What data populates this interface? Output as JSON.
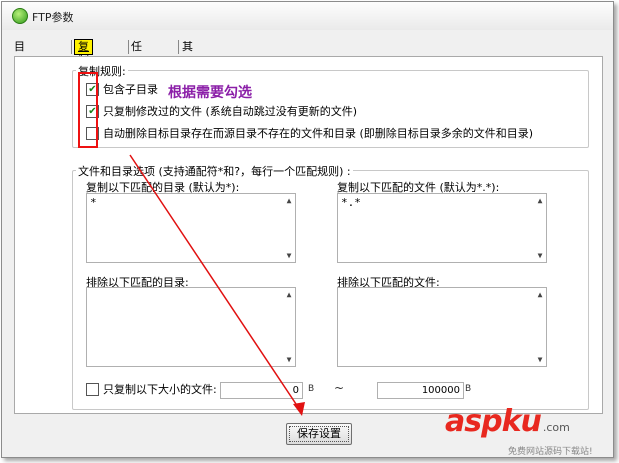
{
  "window": {
    "title": "FTP参数"
  },
  "tabs": [
    {
      "label": "目录设置",
      "active": false
    },
    {
      "label": "复制规则",
      "active": true
    },
    {
      "label": "任务计划",
      "active": false
    },
    {
      "label": "其他选项",
      "active": false
    }
  ],
  "copy_rules": {
    "group_label": "复制规则:",
    "options": [
      {
        "label": "包含子目录",
        "checked": true
      },
      {
        "label": "只复制修改过的文件 (系统自动跳过没有更新的文件)",
        "checked": true
      },
      {
        "label": "自动删除目标目录存在而源目录不存在的文件和目录 (即删除目标目录多余的文件和目录)",
        "checked": false
      }
    ],
    "annotation": "根据需要勾选"
  },
  "filters": {
    "group_label": "文件和目录选项 (支持通配符*和?，每行一个匹配规则) :",
    "copy_dirs_label": "复制以下匹配的目录 (默认为*):",
    "copy_dirs_value": "*",
    "copy_files_label": "复制以下匹配的文件 (默认为*.*):",
    "copy_files_value": "*.*",
    "exclude_dirs_label": "排除以下匹配的目录:",
    "exclude_dirs_value": "",
    "exclude_files_label": "排除以下匹配的文件:",
    "exclude_files_value": "",
    "size_filter": {
      "label": "只复制以下大小的文件:",
      "checked": false,
      "min_value": "0",
      "min_unit": "B",
      "separator": "~",
      "max_value": "100000",
      "max_unit": "B"
    }
  },
  "save_button": "保存设置",
  "watermark": {
    "logo": "aspku",
    "domain": ".com",
    "subtitle": "免费网站源码下载站!"
  },
  "colors": {
    "accent_tab": "#fff200",
    "annotation": "#8b1fa8",
    "highlight_red": "#e11111",
    "check": "#1a7f1a"
  }
}
